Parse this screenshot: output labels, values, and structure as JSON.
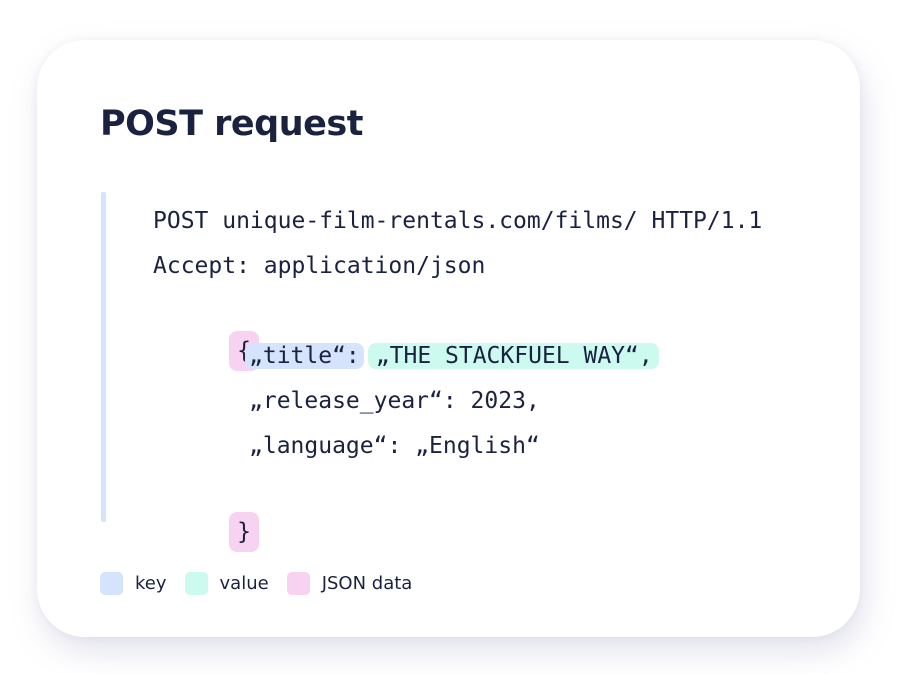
{
  "title": "POST request",
  "code": {
    "line1": "POST unique-film-rentals.com/films/ HTTP/1.1",
    "line2": "Accept: application/json",
    "open_brace": "{",
    "title_key": "„title“:",
    "title_value": "„THE STACKFUEL WAY“,",
    "release_line": "„release_year“: 2023,",
    "language_line": "„language“: „English“",
    "close_brace": "}"
  },
  "legend": {
    "items": [
      {
        "label": "key",
        "color": "#d5e3fd"
      },
      {
        "label": "value",
        "color": "#cdfaef"
      },
      {
        "label": "JSON data",
        "color": "#f8d2f1"
      }
    ]
  },
  "colors": {
    "text": "#1a2240",
    "bar": "#d5e3fd",
    "key": "#d5e3fd",
    "value": "#cdfaef",
    "json": "#f8d2f1"
  }
}
